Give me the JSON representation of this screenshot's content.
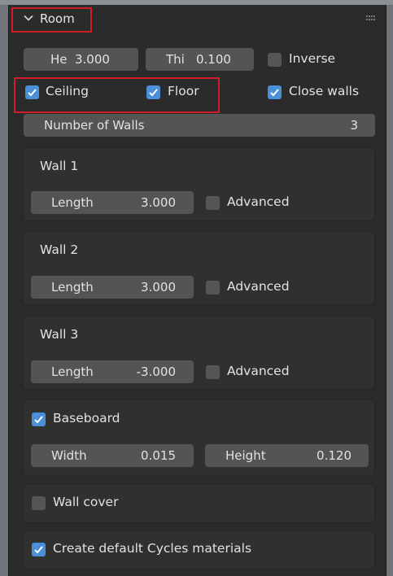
{
  "panel": {
    "title": "Room",
    "height_field": {
      "label": "He",
      "value": "3.000"
    },
    "thickness_field": {
      "label": "Thi",
      "value": "0.100"
    },
    "inverse": {
      "label": "Inverse",
      "checked": false
    },
    "ceiling": {
      "label": "Ceiling",
      "checked": true
    },
    "floor": {
      "label": "Floor",
      "checked": true
    },
    "close_walls": {
      "label": "Close walls",
      "checked": true
    },
    "number_of_walls": {
      "label": "Number of Walls",
      "value": "3"
    }
  },
  "walls": [
    {
      "title": "Wall 1",
      "length_label": "Length",
      "length_value": "3.000",
      "advanced_label": "Advanced"
    },
    {
      "title": "Wall 2",
      "length_label": "Length",
      "length_value": "3.000",
      "advanced_label": "Advanced"
    },
    {
      "title": "Wall 3",
      "length_label": "Length",
      "length_value": "-3.000",
      "advanced_label": "Advanced"
    }
  ],
  "baseboard": {
    "label": "Baseboard",
    "checked": true,
    "width": {
      "label": "Width",
      "value": "0.015"
    },
    "height": {
      "label": "Height",
      "value": "0.120"
    }
  },
  "wall_cover": {
    "label": "Wall cover",
    "checked": false
  },
  "cycles": {
    "label": "Create default Cycles materials",
    "checked": true
  },
  "colors": {
    "accent": "#4a8fd8",
    "highlight_box": "#d01e24",
    "panel_bg": "#2b2b2b",
    "field_bg": "#545454"
  }
}
